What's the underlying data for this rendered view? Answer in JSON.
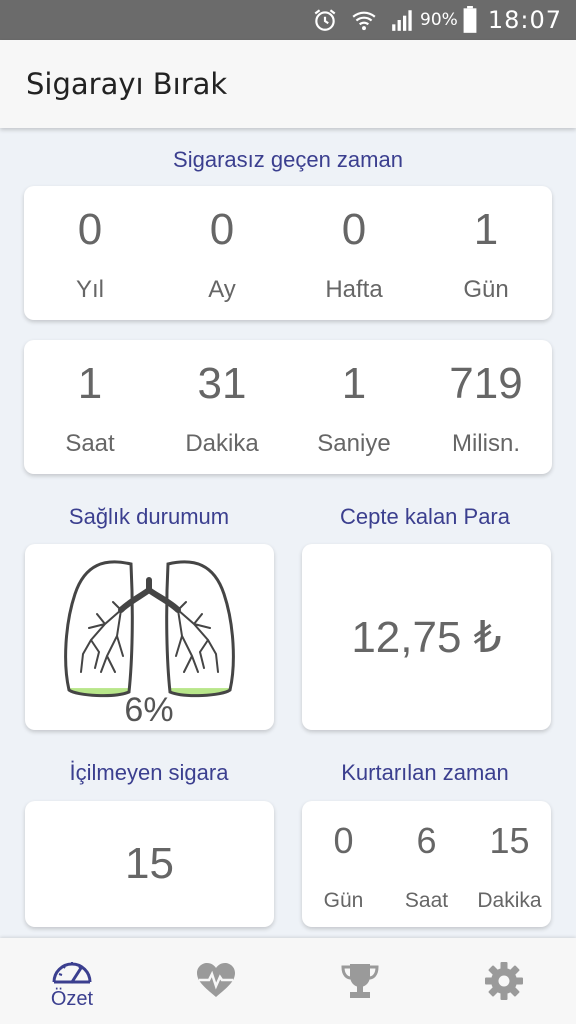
{
  "status_bar": {
    "battery": "90%",
    "time": "18:07",
    "icons": [
      "alarm-icon",
      "wifi-icon",
      "signal-icon",
      "battery-icon"
    ]
  },
  "app_bar": {
    "title": "Sigarayı Bırak"
  },
  "elapsed": {
    "title": "Sigarasız geçen zaman",
    "row1": [
      {
        "value": "0",
        "unit": "Yıl"
      },
      {
        "value": "0",
        "unit": "Ay"
      },
      {
        "value": "0",
        "unit": "Hafta"
      },
      {
        "value": "1",
        "unit": "Gün"
      }
    ],
    "row2": [
      {
        "value": "1",
        "unit": "Saat"
      },
      {
        "value": "31",
        "unit": "Dakika"
      },
      {
        "value": "1",
        "unit": "Saniye"
      },
      {
        "value": "719",
        "unit": "Milisn."
      }
    ]
  },
  "health": {
    "title": "Sağlık durumum",
    "percent_label": "6%",
    "fill_fraction": 0.06,
    "fill_color": "#b8e68a"
  },
  "money": {
    "title": "Cepte kalan Para",
    "value": "12,75 ₺"
  },
  "not_smoked": {
    "title": "İçilmeyen sigara",
    "value": "15"
  },
  "saved_time": {
    "title": "Kurtarılan zaman",
    "items": [
      {
        "value": "0",
        "unit": "Gün"
      },
      {
        "value": "6",
        "unit": "Saat"
      },
      {
        "value": "15",
        "unit": "Dakika"
      }
    ]
  },
  "bottom_nav": [
    {
      "icon": "speedometer-icon",
      "label": "Özet",
      "active": true
    },
    {
      "icon": "heart-pulse-icon",
      "label": "",
      "active": false
    },
    {
      "icon": "trophy-icon",
      "label": "",
      "active": false
    },
    {
      "icon": "gear-icon",
      "label": "",
      "active": false
    }
  ],
  "colors": {
    "accent": "#3b3f8f",
    "inactive_icon": "#9a9a9a",
    "status_bar": "#6b6b6b"
  }
}
